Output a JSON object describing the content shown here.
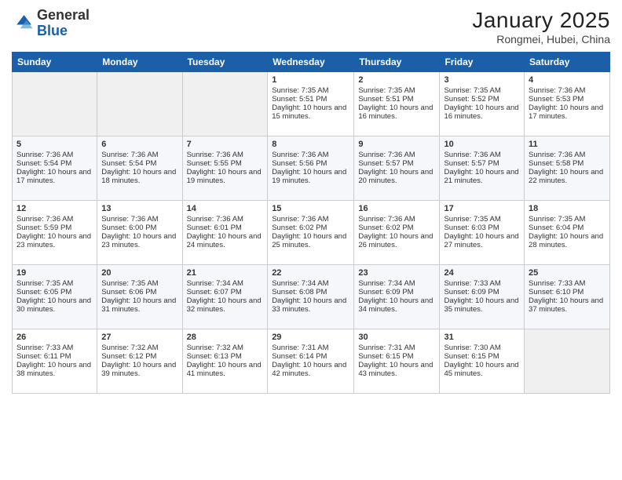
{
  "header": {
    "logo_general": "General",
    "logo_blue": "Blue",
    "month_title": "January 2025",
    "subtitle": "Rongmei, Hubei, China"
  },
  "weekdays": [
    "Sunday",
    "Monday",
    "Tuesday",
    "Wednesday",
    "Thursday",
    "Friday",
    "Saturday"
  ],
  "weeks": [
    [
      {
        "day": "",
        "sunrise": "",
        "sunset": "",
        "daylight": "",
        "empty": true
      },
      {
        "day": "",
        "sunrise": "",
        "sunset": "",
        "daylight": "",
        "empty": true
      },
      {
        "day": "",
        "sunrise": "",
        "sunset": "",
        "daylight": "",
        "empty": true
      },
      {
        "day": "1",
        "sunrise": "Sunrise: 7:35 AM",
        "sunset": "Sunset: 5:51 PM",
        "daylight": "Daylight: 10 hours and 15 minutes."
      },
      {
        "day": "2",
        "sunrise": "Sunrise: 7:35 AM",
        "sunset": "Sunset: 5:51 PM",
        "daylight": "Daylight: 10 hours and 16 minutes."
      },
      {
        "day": "3",
        "sunrise": "Sunrise: 7:35 AM",
        "sunset": "Sunset: 5:52 PM",
        "daylight": "Daylight: 10 hours and 16 minutes."
      },
      {
        "day": "4",
        "sunrise": "Sunrise: 7:36 AM",
        "sunset": "Sunset: 5:53 PM",
        "daylight": "Daylight: 10 hours and 17 minutes."
      }
    ],
    [
      {
        "day": "5",
        "sunrise": "Sunrise: 7:36 AM",
        "sunset": "Sunset: 5:54 PM",
        "daylight": "Daylight: 10 hours and 17 minutes."
      },
      {
        "day": "6",
        "sunrise": "Sunrise: 7:36 AM",
        "sunset": "Sunset: 5:54 PM",
        "daylight": "Daylight: 10 hours and 18 minutes."
      },
      {
        "day": "7",
        "sunrise": "Sunrise: 7:36 AM",
        "sunset": "Sunset: 5:55 PM",
        "daylight": "Daylight: 10 hours and 19 minutes."
      },
      {
        "day": "8",
        "sunrise": "Sunrise: 7:36 AM",
        "sunset": "Sunset: 5:56 PM",
        "daylight": "Daylight: 10 hours and 19 minutes."
      },
      {
        "day": "9",
        "sunrise": "Sunrise: 7:36 AM",
        "sunset": "Sunset: 5:57 PM",
        "daylight": "Daylight: 10 hours and 20 minutes."
      },
      {
        "day": "10",
        "sunrise": "Sunrise: 7:36 AM",
        "sunset": "Sunset: 5:57 PM",
        "daylight": "Daylight: 10 hours and 21 minutes."
      },
      {
        "day": "11",
        "sunrise": "Sunrise: 7:36 AM",
        "sunset": "Sunset: 5:58 PM",
        "daylight": "Daylight: 10 hours and 22 minutes."
      }
    ],
    [
      {
        "day": "12",
        "sunrise": "Sunrise: 7:36 AM",
        "sunset": "Sunset: 5:59 PM",
        "daylight": "Daylight: 10 hours and 23 minutes."
      },
      {
        "day": "13",
        "sunrise": "Sunrise: 7:36 AM",
        "sunset": "Sunset: 6:00 PM",
        "daylight": "Daylight: 10 hours and 23 minutes."
      },
      {
        "day": "14",
        "sunrise": "Sunrise: 7:36 AM",
        "sunset": "Sunset: 6:01 PM",
        "daylight": "Daylight: 10 hours and 24 minutes."
      },
      {
        "day": "15",
        "sunrise": "Sunrise: 7:36 AM",
        "sunset": "Sunset: 6:02 PM",
        "daylight": "Daylight: 10 hours and 25 minutes."
      },
      {
        "day": "16",
        "sunrise": "Sunrise: 7:36 AM",
        "sunset": "Sunset: 6:02 PM",
        "daylight": "Daylight: 10 hours and 26 minutes."
      },
      {
        "day": "17",
        "sunrise": "Sunrise: 7:35 AM",
        "sunset": "Sunset: 6:03 PM",
        "daylight": "Daylight: 10 hours and 27 minutes."
      },
      {
        "day": "18",
        "sunrise": "Sunrise: 7:35 AM",
        "sunset": "Sunset: 6:04 PM",
        "daylight": "Daylight: 10 hours and 28 minutes."
      }
    ],
    [
      {
        "day": "19",
        "sunrise": "Sunrise: 7:35 AM",
        "sunset": "Sunset: 6:05 PM",
        "daylight": "Daylight: 10 hours and 30 minutes."
      },
      {
        "day": "20",
        "sunrise": "Sunrise: 7:35 AM",
        "sunset": "Sunset: 6:06 PM",
        "daylight": "Daylight: 10 hours and 31 minutes."
      },
      {
        "day": "21",
        "sunrise": "Sunrise: 7:34 AM",
        "sunset": "Sunset: 6:07 PM",
        "daylight": "Daylight: 10 hours and 32 minutes."
      },
      {
        "day": "22",
        "sunrise": "Sunrise: 7:34 AM",
        "sunset": "Sunset: 6:08 PM",
        "daylight": "Daylight: 10 hours and 33 minutes."
      },
      {
        "day": "23",
        "sunrise": "Sunrise: 7:34 AM",
        "sunset": "Sunset: 6:09 PM",
        "daylight": "Daylight: 10 hours and 34 minutes."
      },
      {
        "day": "24",
        "sunrise": "Sunrise: 7:33 AM",
        "sunset": "Sunset: 6:09 PM",
        "daylight": "Daylight: 10 hours and 35 minutes."
      },
      {
        "day": "25",
        "sunrise": "Sunrise: 7:33 AM",
        "sunset": "Sunset: 6:10 PM",
        "daylight": "Daylight: 10 hours and 37 minutes."
      }
    ],
    [
      {
        "day": "26",
        "sunrise": "Sunrise: 7:33 AM",
        "sunset": "Sunset: 6:11 PM",
        "daylight": "Daylight: 10 hours and 38 minutes."
      },
      {
        "day": "27",
        "sunrise": "Sunrise: 7:32 AM",
        "sunset": "Sunset: 6:12 PM",
        "daylight": "Daylight: 10 hours and 39 minutes."
      },
      {
        "day": "28",
        "sunrise": "Sunrise: 7:32 AM",
        "sunset": "Sunset: 6:13 PM",
        "daylight": "Daylight: 10 hours and 41 minutes."
      },
      {
        "day": "29",
        "sunrise": "Sunrise: 7:31 AM",
        "sunset": "Sunset: 6:14 PM",
        "daylight": "Daylight: 10 hours and 42 minutes."
      },
      {
        "day": "30",
        "sunrise": "Sunrise: 7:31 AM",
        "sunset": "Sunset: 6:15 PM",
        "daylight": "Daylight: 10 hours and 43 minutes."
      },
      {
        "day": "31",
        "sunrise": "Sunrise: 7:30 AM",
        "sunset": "Sunset: 6:15 PM",
        "daylight": "Daylight: 10 hours and 45 minutes."
      },
      {
        "day": "",
        "sunrise": "",
        "sunset": "",
        "daylight": "",
        "empty": true
      }
    ]
  ]
}
